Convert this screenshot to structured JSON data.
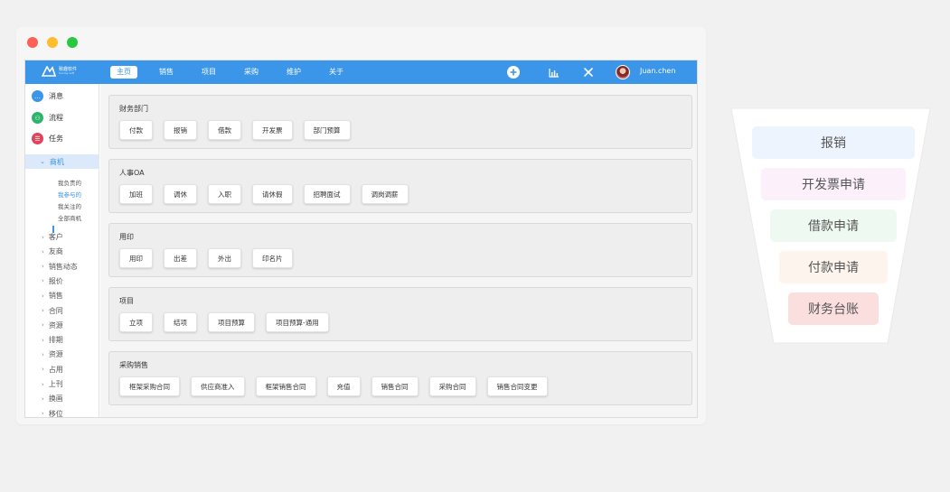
{
  "window": {
    "controls": [
      "close",
      "minimize",
      "maximize"
    ]
  },
  "topbar": {
    "logo_line1": "致趣软件",
    "logo_line2": "hunray soft",
    "nav": [
      "主页",
      "销售",
      "项目",
      "采购",
      "维护",
      "关于"
    ],
    "active_nav": "主页",
    "tools": [
      "add-icon",
      "chart-icon",
      "tools-icon"
    ],
    "username": "Juan.chen"
  },
  "sidebar": {
    "main": [
      {
        "label": "消息",
        "icon": "message-icon",
        "color": "#3b95e8"
      },
      {
        "label": "流程",
        "icon": "flow-icon",
        "color": "#2ab56a"
      },
      {
        "label": "任务",
        "icon": "task-icon",
        "color": "#e0445b"
      }
    ],
    "expanded": "商机",
    "sub": [
      "我负责的",
      "我参与的",
      "我关注的",
      "全部商机"
    ],
    "selected_sub": "我参与的",
    "categories": [
      "客户",
      "友商",
      "销售动态",
      "报价",
      "销售",
      "合同",
      "资源",
      "排期",
      "资源",
      "占用",
      "上刊",
      "换画",
      "移位"
    ]
  },
  "panels": [
    {
      "title": "财务部门",
      "buttons": [
        "付款",
        "报销",
        "借款",
        "开发票",
        "部门预算"
      ]
    },
    {
      "title": "人事OA",
      "buttons": [
        "加班",
        "调休",
        "入职",
        "请休假",
        "招聘面试",
        "调岗调薪"
      ]
    },
    {
      "title": "用印",
      "buttons": [
        "用印",
        "出差",
        "外出",
        "印名片"
      ]
    },
    {
      "title": "项目",
      "buttons": [
        "立项",
        "结项",
        "项目预算",
        "项目预算-通用"
      ]
    },
    {
      "title": "采购销售",
      "buttons": [
        "框架采购合同",
        "供应商准入",
        "框架销售合同",
        "充值",
        "销售合同",
        "采购合同",
        "销售合同变更"
      ]
    }
  ],
  "funnel": [
    {
      "label": "报销",
      "color": "#eef4fd"
    },
    {
      "label": "开发票申请",
      "color": "#fcf1fb"
    },
    {
      "label": "借款申请",
      "color": "#eefaf1"
    },
    {
      "label": "付款申请",
      "color": "#fcf4ed"
    },
    {
      "label": "财务台账",
      "color": "#fbdede"
    }
  ],
  "colors": {
    "accent": "#3b95e8",
    "background": "#f1f1f2"
  }
}
